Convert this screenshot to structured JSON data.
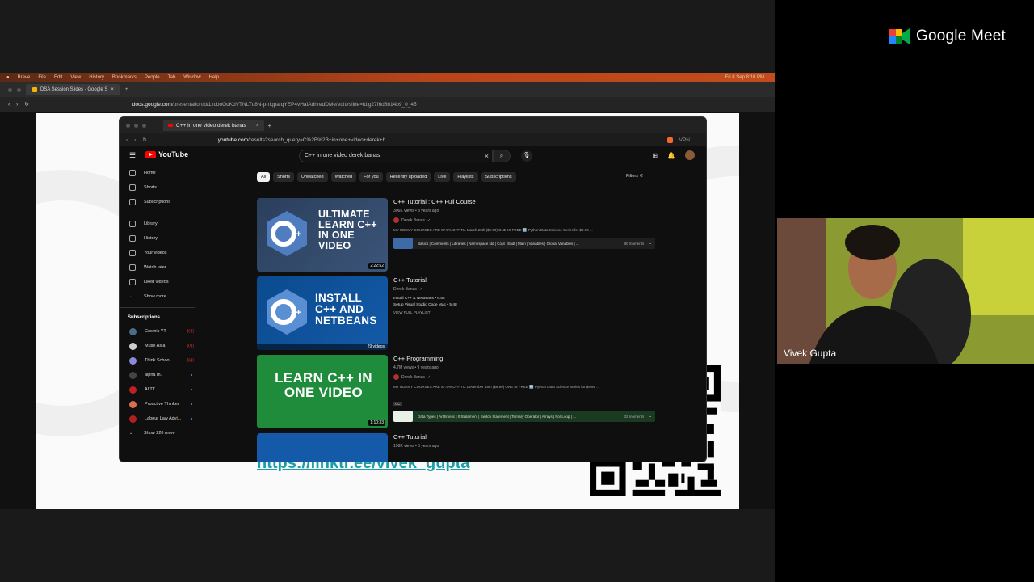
{
  "meet": {
    "brand": "Google Meet",
    "participant_name": "Vivek Gupta"
  },
  "mac": {
    "menu_items": [
      "Brave",
      "File",
      "Edit",
      "View",
      "History",
      "Bookmarks",
      "People",
      "Tab",
      "Window",
      "Help"
    ],
    "clock": "Fri 8 Sep 8:10 PM"
  },
  "outer_browser": {
    "tab_title": "DSA Session Slides - Google S",
    "url_host": "docs.google.com",
    "url_path": "/presentation/d/1xcboOuKdVTNLTu8N-p-rlqpaIqYEP4vHaIAdhredDMe/edit#slide=id.g27f6d6b14b9_0_45"
  },
  "slide": {
    "link": "https://linktr.ee/vivek_gupta"
  },
  "yt_browser": {
    "tab_title": "C++ in one video derek banas",
    "url_host": "youtube.com",
    "url_path": "/results?search_query=C%2B%2B+in+one+video+derek+b...",
    "vpn": "VPN"
  },
  "yt": {
    "logo": "YouTube",
    "search_value": "C++ in one video derek banas",
    "sidebar": [
      {
        "label": "Home",
        "icon": "home-icon"
      },
      {
        "label": "Shorts",
        "icon": "shorts-icon"
      },
      {
        "label": "Subscriptions",
        "icon": "subscriptions-icon"
      },
      {
        "label": "Library",
        "icon": "library-icon"
      },
      {
        "label": "History",
        "icon": "history-icon"
      },
      {
        "label": "Your videos",
        "icon": "your-videos-icon"
      },
      {
        "label": "Watch later",
        "icon": "watch-later-icon"
      },
      {
        "label": "Liked videos",
        "icon": "liked-videos-icon"
      },
      {
        "label": "Show more",
        "icon": "chevron-down-icon"
      }
    ],
    "subscriptions_heading": "Subscriptions",
    "subscriptions": [
      {
        "name": "Cosmic YT",
        "color": "#4a6e8a",
        "live": true
      },
      {
        "name": "Muse Asia",
        "color": "#cccccc",
        "live": true
      },
      {
        "name": "Think School",
        "color": "#8a8ad8",
        "live": true
      },
      {
        "name": "alpha m.",
        "color": "#444444",
        "live": false
      },
      {
        "name": "ALTT",
        "color": "#c02020",
        "live": false
      },
      {
        "name": "Proactive Thinker",
        "color": "#d87050",
        "live": false
      },
      {
        "name": "Labour Law Advi...",
        "color": "#b02020",
        "live": false
      }
    ],
    "show_more_subs": "Show 220 more",
    "chips": [
      "All",
      "Shorts",
      "Unwatched",
      "Watched",
      "For you",
      "Recently uploaded",
      "Live",
      "Playlists",
      "Subscriptions"
    ],
    "filters": "Filters",
    "results": [
      {
        "thumb_text": "ULTIMATE LEARN C++ IN ONE VIDEO",
        "duration": "2:22:52",
        "title": "C++ Tutorial : C++ Full Course",
        "meta": "306K views • 3 years ago",
        "channel": "Derek Banas",
        "desc": "MY UDEMY COURSES ARE 87.5% OFF TIL March 26th ($9.99) ONE IS FREE 🆓 Python Data Science Series for $9.99 ...",
        "moments": "Basics | Comments | Libraries | Namespace std | Cout | Endl | Main | Variables | Global Variables | ...",
        "moments_count": "80 moments"
      },
      {
        "thumb_text": "INSTALL C++ AND NETBEANS",
        "playlist_count": "29 videos",
        "title": "C++ Tutorial",
        "channel": "Derek Banas",
        "lines": [
          "Install C++ & NetBeans • 6:56",
          "Setup Visual Studio Code Mac • 5:48"
        ],
        "view_playlist": "VIEW FULL PLAYLIST"
      },
      {
        "thumb_text": "LEARN C++ IN ONE VIDEO",
        "duration": "1:10:33",
        "title": "C++ Programming",
        "meta": "4.7M views • 9 years ago",
        "channel": "Derek Banas",
        "desc": "MY UDEMY COURSES ARE 87.5% OFF TIL December 19th ($9.99) ONE IS FREE 🆓 Python Data Science Series for $9.99 ...",
        "badge": "CC",
        "moments": "Data Types | Arithmetic | If Statement | Switch Statement | Ternary Operator | Arrays | For Loop | ...",
        "moments_count": "32 moments"
      },
      {
        "title": "C++ Tutorial",
        "meta": "198K views • 5 years ago"
      }
    ]
  }
}
